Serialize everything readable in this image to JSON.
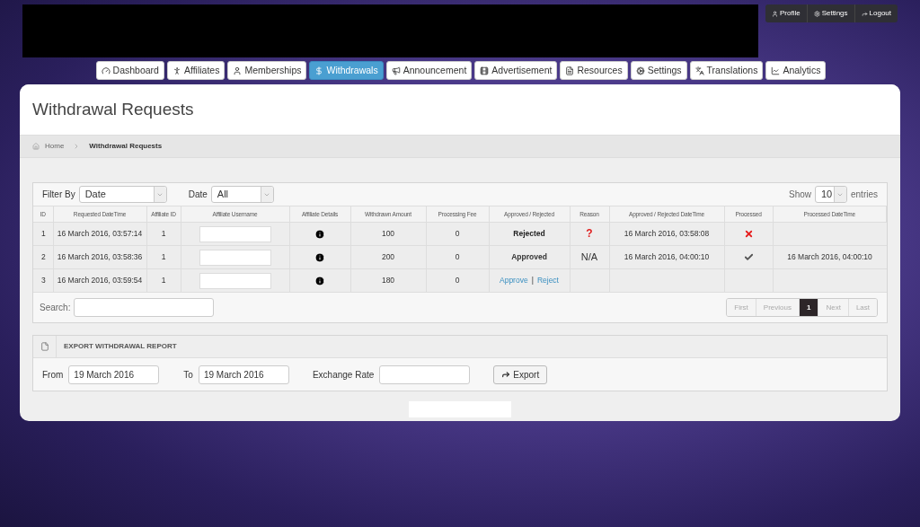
{
  "user_menu": [
    {
      "label": "Profile"
    },
    {
      "label": "Settings"
    },
    {
      "label": "Logout"
    }
  ],
  "nav": [
    {
      "label": "Dashboard",
      "selected": false
    },
    {
      "label": "Affiliates",
      "selected": false
    },
    {
      "label": "Memberships",
      "selected": false
    },
    {
      "label": "Withdrawals",
      "selected": true
    },
    {
      "label": "Announcement",
      "selected": false
    },
    {
      "label": "Advertisement",
      "selected": false
    },
    {
      "label": "Resources",
      "selected": false
    },
    {
      "label": "Settings",
      "selected": false
    },
    {
      "label": "Translations",
      "selected": false
    },
    {
      "label": "Analytics",
      "selected": false
    }
  ],
  "page_title": "Withdrawal Requests",
  "breadcrumb": [
    "Home",
    "Withdrawal Requests"
  ],
  "filters": {
    "filter_by_label": "Filter By",
    "filter_by_value": "Date",
    "date_label": "Date",
    "date_value": "All",
    "show_label": "Show",
    "show_value": "10",
    "entries_label": "entries"
  },
  "table": {
    "columns": [
      "ID",
      "Requested DateTime",
      "Affiliate ID",
      "Affiliate Username",
      "Affiliate Details",
      "Withdrawn Amount",
      "Processing Fee",
      "Approved / Rejected",
      "Reason",
      "Approved / Rejected DateTime",
      "Processed",
      "Processed DateTime"
    ],
    "rows": [
      {
        "id": "1",
        "requested": "16 March 2016, 03:57:14",
        "affiliate_id": "1",
        "amount": "100",
        "fee": "0",
        "status": {
          "kind": "rejected",
          "text": "Rejected"
        },
        "reason": {
          "kind": "question",
          "text": "?"
        },
        "decided": "16 March 2016, 03:58:08",
        "processed": {
          "kind": "no"
        }
      },
      {
        "id": "2",
        "requested": "16 March 2016, 03:58:36",
        "affiliate_id": "1",
        "amount": "200",
        "fee": "0",
        "status": {
          "kind": "approved",
          "text": "Approved"
        },
        "reason": {
          "kind": "text",
          "text": "N/A"
        },
        "decided": "16 March 2016, 04:00:10",
        "processed": {
          "kind": "yes"
        },
        "processed_at": "16 March 2016, 04:00:10"
      },
      {
        "id": "3",
        "requested": "16 March 2016, 03:59:54",
        "affiliate_id": "1",
        "amount": "180",
        "fee": "0",
        "status": {
          "kind": "pending",
          "approve": "Approve",
          "separator": "|",
          "reject": "Reject"
        }
      }
    ]
  },
  "search_label": "Search:",
  "pagination": [
    {
      "label": "First",
      "selected": false
    },
    {
      "label": "Previous",
      "selected": false
    },
    {
      "label": "1",
      "selected": true
    },
    {
      "label": "Next",
      "selected": false
    },
    {
      "label": "Last",
      "selected": false
    }
  ],
  "export": {
    "title": "EXPORT WITHDRAWAL REPORT",
    "from_label": "From",
    "from_value": "19 March 2016",
    "to_label": "To",
    "to_value": "19 March 2016",
    "rate_label": "Exchange Rate",
    "button": "Export"
  }
}
